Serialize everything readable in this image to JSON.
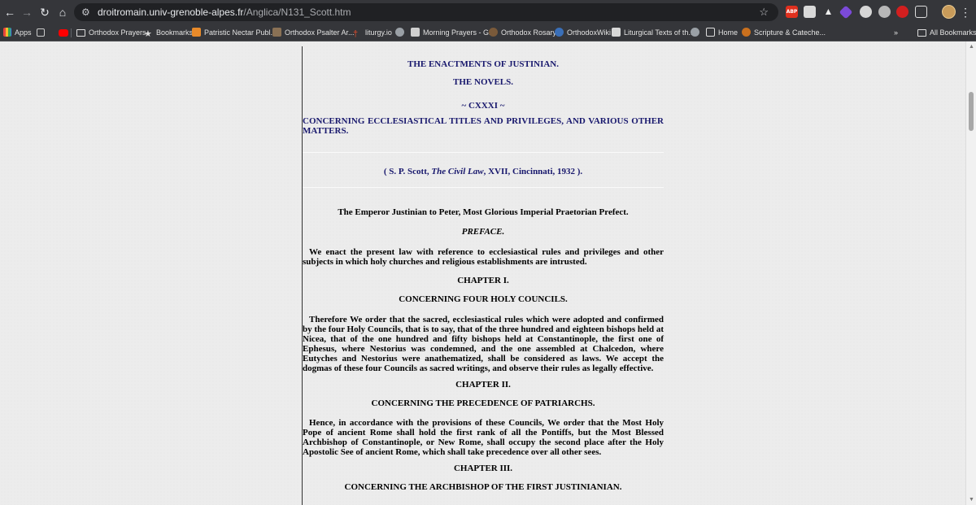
{
  "browser": {
    "url_host": "droitromain.univ-grenoble-alpes.fr",
    "url_path": "/Anglica/N131_Scott.htm",
    "abp_label": "ABP"
  },
  "bookmarks": {
    "apps": "Apps",
    "items": [
      "Orthodox Prayers",
      "Bookmarks",
      "Patristic Nectar Publ...",
      "Orthodox Psalter Ar...",
      "liturgy.io",
      "Morning Prayers - G...",
      "Orthodox Rosary",
      "OrthodoxWiki",
      "Liturgical Texts of th...",
      "Home",
      "Scripture & Cateche..."
    ],
    "overflow": "»",
    "all": "All Bookmarks"
  },
  "doc": {
    "title1": "THE ENACTMENTS OF JUSTINIAN.",
    "title2": "THE NOVELS.",
    "number": "~ CXXXI ~",
    "subject": "CONCERNING ECCLESIASTICAL TITLES AND PRIVILEGES, AND VARIOUS OTHER MATTERS.",
    "source_pre": "( S. P. Scott, ",
    "source_italic": "The Civil Law",
    "source_post": ", XVII, Cincinnati, 1932 ).",
    "address": "The Emperor Justinian to Peter, Most Glorious Imperial Praetorian Prefect.",
    "preface": "PREFACE.",
    "preface_text": "We enact the present law with reference to ecclesiastical rules and privileges and other subjects in which holy churches and religious establishments are intrusted.",
    "ch1": "CHAPTER I.",
    "ch1_title": "CONCERNING FOUR HOLY COUNCILS.",
    "ch1_text": "Therefore We order that the sacred, ecclesiastical rules which were adopted and confirmed by the four Holy Councils, that is to say, that of the three hundred and eighteen bishops held at Nicea, that of the one hundred and fifty bishops held at Constantinople, the first one of Ephesus, where Nestorius was condemned, and the one assembled at Chalcedon, where Eutyches and Nestorius were anathematized, shall be considered as laws. We accept the dogmas of these four Councils as sacred writings, and observe their rules as legally effective.",
    "ch2": "CHAPTER II.",
    "ch2_title": "CONCERNING THE PRECEDENCE OF PATRIARCHS.",
    "ch2_text": "Hence, in accordance with the provisions of these Councils, We order that the Most Holy Pope of ancient Rome shall hold the first rank of all the Pontiffs, but the Most Blessed Archbishop of Constantinople, or New Rome, shall occupy the second place after the Holy Apostolic See of ancient Rome, which shall take precedence over all other sees.",
    "ch3": "CHAPTER III.",
    "ch3_title": "CONCERNING THE ARCHBISHOP OF THE FIRST JUSTINIANIAN."
  }
}
